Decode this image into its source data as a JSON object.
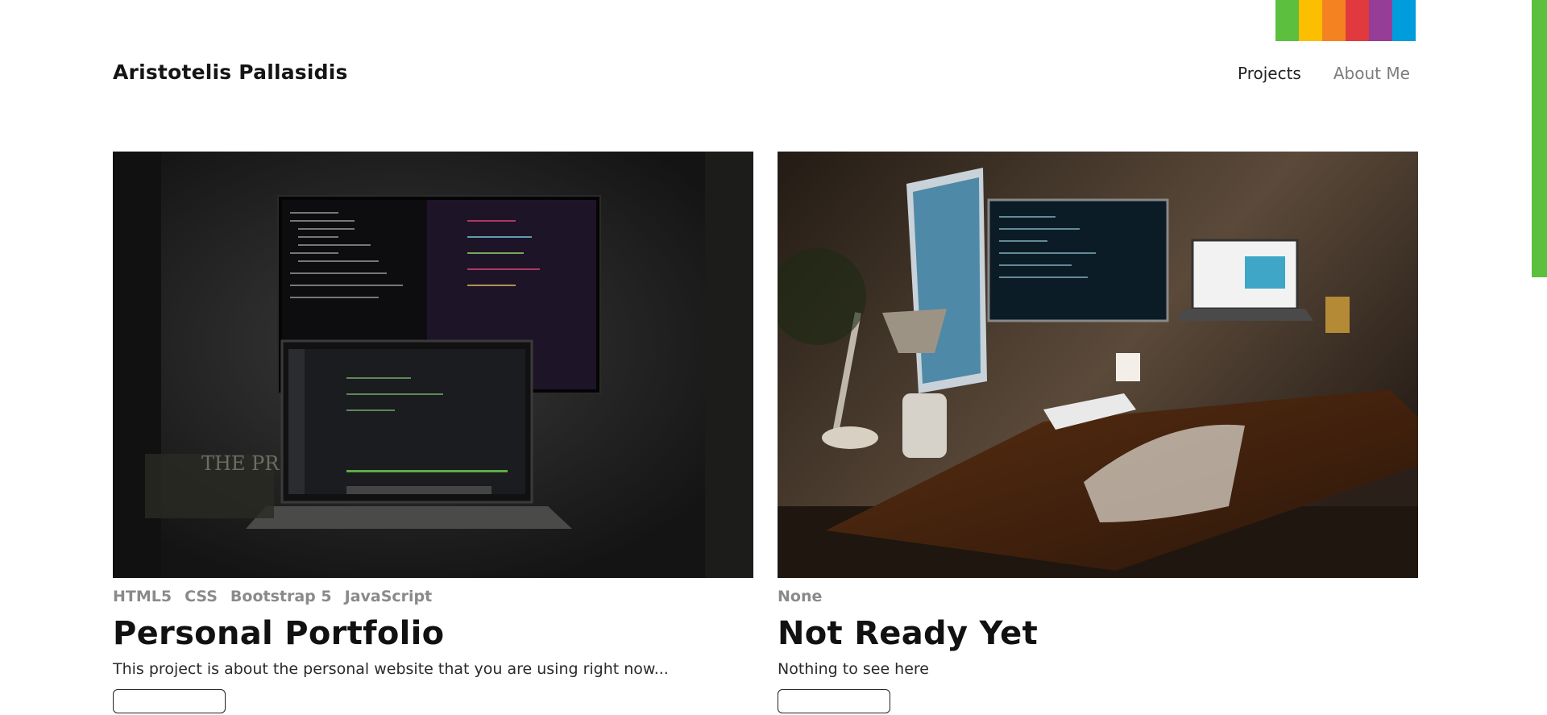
{
  "header": {
    "brand": "Aristotelis Pallasidis",
    "nav": [
      {
        "label": "Projects"
      },
      {
        "label": "About Me"
      }
    ]
  },
  "rainbow_colors": [
    "#5cbf3e",
    "#fbbf00",
    "#f58220",
    "#e0393e",
    "#963d97",
    "#009ddc"
  ],
  "side_bar_color": "#5cbf3e",
  "projects": [
    {
      "image": "night-desk-monitor-laptop-code-photo",
      "tags": [
        "HTML5",
        "CSS",
        "Bootstrap 5",
        "JavaScript"
      ],
      "title": "Personal Portfolio",
      "description": "This project is about the personal website that you are using right now..."
    },
    {
      "image": "wooden-desk-lamp-monitors-laptop-photo",
      "tags": [
        "None"
      ],
      "title": "Not Ready Yet",
      "description": "Nothing to see here"
    }
  ]
}
